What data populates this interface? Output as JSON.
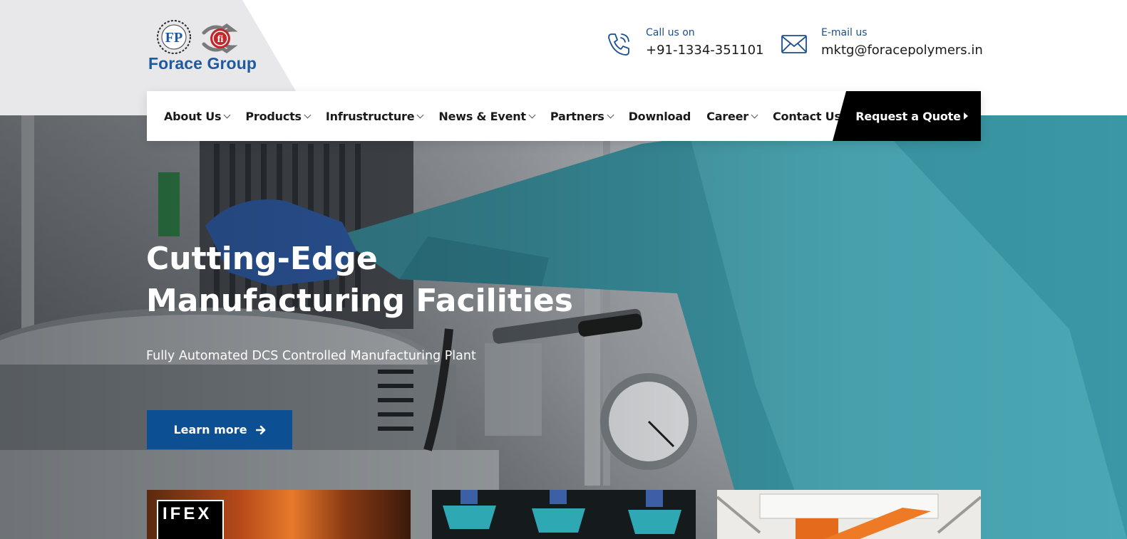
{
  "brand": {
    "name": "Forace Group",
    "mark_left": "FP",
    "mark_right": "fi",
    "colors": {
      "primary": "#0d4f93",
      "text_blue": "#1e5aa0",
      "mark_red": "#c0282d",
      "dark": "#000000"
    }
  },
  "contacts": [
    {
      "label": "Call us on",
      "value": "+91-1334-351101",
      "icon": "phone-icon"
    },
    {
      "label": "E-mail us",
      "value": "mktg@foracepolymers.in",
      "icon": "envelope-icon"
    }
  ],
  "nav": {
    "items": [
      {
        "label": "About Us",
        "dropdown": true
      },
      {
        "label": "Products",
        "dropdown": true
      },
      {
        "label": "Infrustructure",
        "dropdown": true
      },
      {
        "label": "News & Event",
        "dropdown": true
      },
      {
        "label": "Partners",
        "dropdown": true
      },
      {
        "label": "Download",
        "dropdown": false
      },
      {
        "label": "Career",
        "dropdown": true
      },
      {
        "label": "Contact Us",
        "dropdown": true
      }
    ],
    "cta": "Request a Quote"
  },
  "hero": {
    "title_line1": "Cutting-Edge",
    "title_line2": "Manufacturing Facilities",
    "subtitle": "Fully Automated DCS Controlled Manufacturing Plant",
    "button": "Learn more"
  },
  "cards": [
    {
      "badge": "IFEX"
    }
  ]
}
